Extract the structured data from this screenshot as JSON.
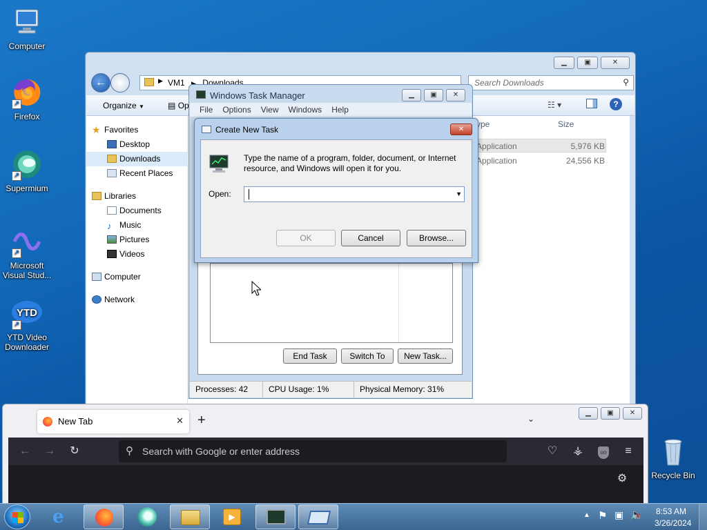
{
  "desktop": {
    "icons": [
      {
        "label": "Computer"
      },
      {
        "label": "Firefox"
      },
      {
        "label": "Supermium"
      },
      {
        "label": "Microsoft Visual Stud..."
      },
      {
        "label": "YTD Video Downloader"
      },
      {
        "label": "Recycle Bin"
      }
    ]
  },
  "explorer": {
    "address": [
      "VM1",
      "Downloads"
    ],
    "search_placeholder": "Search Downloads",
    "organize_label": "Organize",
    "open_label": "Op",
    "sidebar": {
      "favorites": "Favorites",
      "desktop": "Desktop",
      "downloads": "Downloads",
      "recent": "Recent Places",
      "libraries": "Libraries",
      "documents": "Documents",
      "music": "Music",
      "pictures": "Pictures",
      "videos": "Videos",
      "computer": "Computer",
      "network": "Network"
    },
    "columns": {
      "type": "ype",
      "size": "Size"
    },
    "files": [
      {
        "type": "Application",
        "size": "5,976 KB"
      },
      {
        "type": "Application",
        "size": "24,556 KB"
      }
    ]
  },
  "taskmgr": {
    "title": "Windows Task Manager",
    "menu": [
      "File",
      "Options",
      "View",
      "Windows",
      "Help"
    ],
    "buttons": {
      "end_task": "End Task",
      "switch_to": "Switch To",
      "new_task": "New Task..."
    },
    "status": {
      "processes": "Processes: 42",
      "cpu": "CPU Usage: 1%",
      "memory": "Physical Memory: 31%"
    }
  },
  "run_dialog": {
    "title": "Create New Task",
    "description": "Type the name of a program, folder, document, or Internet resource, and Windows will open it for you.",
    "open_label": "Open:",
    "open_value": "",
    "ok_label": "OK",
    "cancel_label": "Cancel",
    "browse_label": "Browse..."
  },
  "firefox": {
    "tab_title": "New Tab",
    "url_placeholder": "Search with Google or enter address"
  },
  "taskbar": {
    "time": "8:53 AM",
    "date": "3/26/2024"
  }
}
